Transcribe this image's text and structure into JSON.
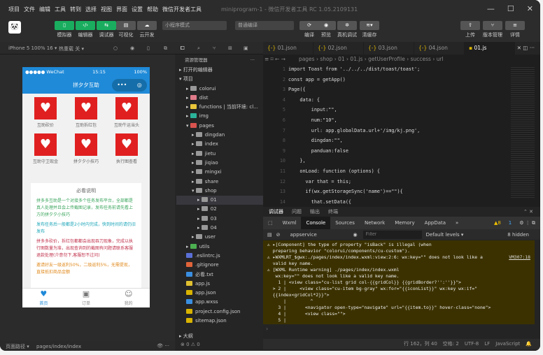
{
  "menu": [
    "项目",
    "文件",
    "编辑",
    "工具",
    "转到",
    "选择",
    "视图",
    "界面",
    "设置",
    "帮助",
    "微信开发者工具"
  ],
  "window_title": "miniprogram-1 - 微信开发者工具 RC 1.05.2109131",
  "toolbar": {
    "left": [
      "模拟器",
      "编辑器",
      "调试器",
      "可视化",
      "云开发"
    ],
    "mode": "小程序模式",
    "compile": "普通编译",
    "actions": [
      "编译",
      "预览",
      "真机调试",
      "清缓存"
    ],
    "right": [
      "上传",
      "版本管理",
      "详情"
    ]
  },
  "sim_bar": {
    "device": "iPhone 5 100% 16 ▾",
    "hotreload": "热重载 关 ▾"
  },
  "phone": {
    "carrier": "●●●●● WeChat",
    "time": "15:15",
    "battery": "100%",
    "title": "拼夕夕互助",
    "grid": [
      "互助砍价",
      "互助拆红包",
      "互助牛运当头",
      "互助守卫现金",
      "拼夕夕小技巧",
      "执行图查看"
    ],
    "notice_title": "必看说明",
    "notice": [
      "拼多多互助是一个对接多个任务发布平台，全部都是真人处理并且会上传截图记录，发布任务前请先看上方的拼夕夕小技巧",
      "发布任务后一般都是2小时内完成，快到时间的请仍旧发布",
      "拼多多砍价，拆红包都都会出现吞刀现象，完成以执行图数量为准，出现查询到的截图有问题请联系客服退款处理(介意勿下,客服恕不过问)",
      "邀请好友一级返利50%，二级返利5%，无需提现，直接抵扣商品金额"
    ],
    "tabs": [
      "首页",
      "订单",
      "我的"
    ]
  },
  "sim_footer": {
    "path_label": "页面路径 ▾",
    "path": "pages/index/index"
  },
  "explorer": {
    "title": "资源管理器",
    "open_editors": "打开的编辑器",
    "project": "项目",
    "tree": [
      "colorui",
      "dist",
      "functions | 当前环境: cl...",
      "img",
      "pages",
      "dingdan",
      "index",
      "jietu",
      "jiqiao",
      "mingxi",
      "share",
      "shop",
      "01",
      "02",
      "03",
      "04",
      "user",
      "utils",
      ".eslintrc.js",
      ".gitignore",
      "必看.txt",
      "app.js",
      "app.json",
      "app.wxss",
      "project.config.json",
      "sitemap.json"
    ],
    "outline": "大纲",
    "problems": "⊗ 0 ⚠ 0"
  },
  "editor": {
    "tabs": [
      "01.json",
      "02.json",
      "03.json",
      "04.json",
      "01.js"
    ],
    "breadcrumb": "pages › shop › 01 › 01.js › getUserProfile › success › url",
    "code": [
      "import Toast from '../../../dist/toast/toast';",
      "const app = getApp()",
      "Page({",
      "    data: {",
      "        input:\"\",",
      "        num:\"10\",",
      "        url: app.globalData.url+'/img/kj.png',",
      "        dingdan:\"\",",
      "        panduan:false",
      "    },",
      "    onLoad: function (options) {",
      "      var that = this;",
      "      if(wx.getStorageSync('name')==\"\"){",
      "        that.setData({"
    ]
  },
  "devtools": {
    "panels": [
      "调试器",
      "问题",
      "输出",
      "终端"
    ],
    "tabs": [
      "Wxml",
      "Console",
      "Sources",
      "Network",
      "Memory",
      "AppData",
      "»"
    ],
    "badge_warn": "▲8",
    "badge_info": "1",
    "context": "appservice",
    "filter_placeholder": "Filter",
    "levels": "Default levels ▾",
    "hidden": "8 hidden",
    "console": [
      "⚠ ▸[Component] the type of property \"isBack\" is illegal (when",
      "  preparing behavior \"colorui/components/cu-custom\").",
      "⚠ ▸WXMLRT_$gwx:./pages/index/index.wxml:view:2:6: wx:key=\"\" does not look like a",
      "  valid key name.",
      "⚠ [WXML Runtime warning] ./pages/index/index.wxml",
      "   wx:key=\"\" does not look like a valid key name.",
      "    1 | <view class=\"cu-list grid col-{{gridCol}} {{gridBorder?'':''}}\">",
      "  > 2 |     <view class=\"cu-item bg-gray\" wx:for=\"{{iconList}}\" wx:key wx:if=\"",
      "  {{index<gridCol*2}}\">",
      "      |         ^",
      "    3 |       <navigator open-type=\"navigate\" url=\"{{item.to}}\" hover-class=\"none\">",
      "    4 |       <view class=\"\">",
      "    5 |"
    ],
    "console_link": "VM307:18"
  },
  "status": [
    "行 162，列 40",
    "空格: 2",
    "UTF-8",
    "LF",
    "JavaScript"
  ],
  "colors": {
    "accent_green": "#1aad5f",
    "nav_blue": "#1f8ad8",
    "warn_bg": "#3b3100"
  }
}
